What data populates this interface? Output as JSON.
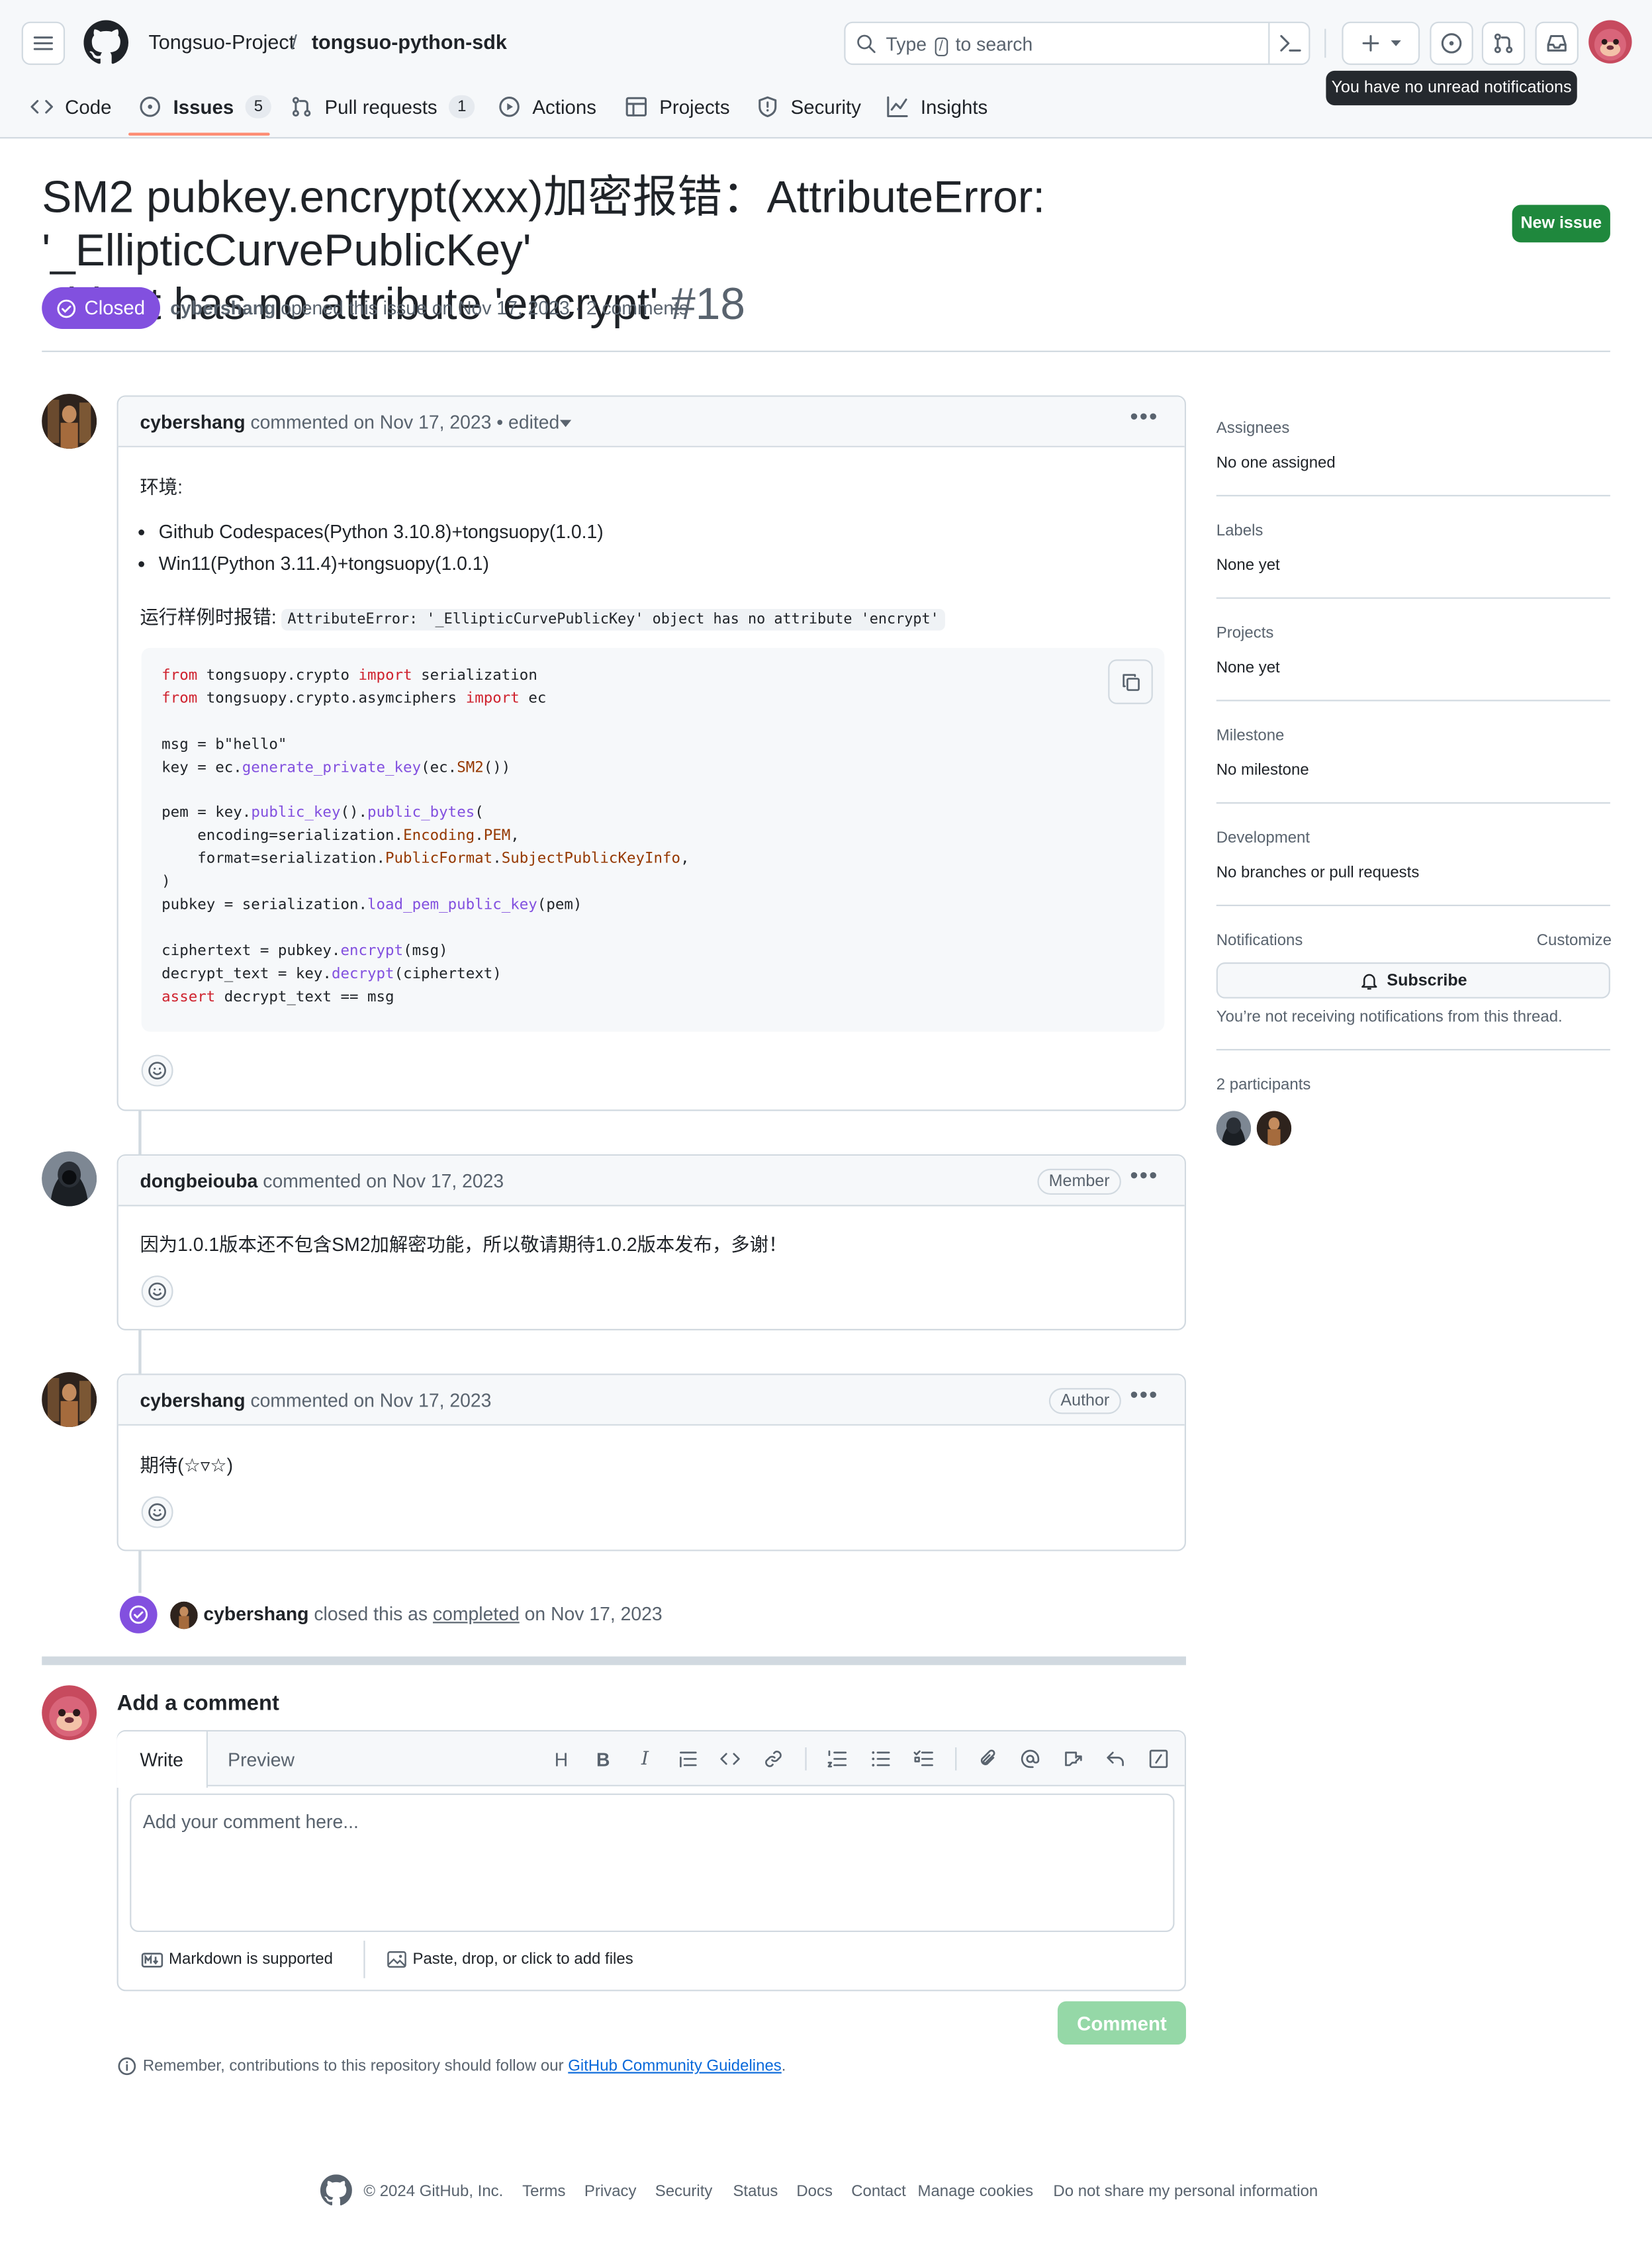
{
  "header": {
    "org": "Tongsuo-Project",
    "sep": "/",
    "repo": "tongsuo-python-sdk",
    "search_pre": "Type",
    "search_key": "/",
    "search_post": "to search",
    "tooltip": "You have no unread notifications"
  },
  "tabs": [
    {
      "label": "Code"
    },
    {
      "label": "Issues",
      "count": "5"
    },
    {
      "label": "Pull requests",
      "count": "1"
    },
    {
      "label": "Actions"
    },
    {
      "label": "Projects"
    },
    {
      "label": "Security"
    },
    {
      "label": "Insights"
    }
  ],
  "issue": {
    "title_line1": "SM2 pubkey.encrypt(xxx)加密报错：AttributeError: '_EllipticCurvePublicKey'",
    "title_line2": "object has no attribute 'encrypt'",
    "number": "#18",
    "new_issue": "New issue",
    "state": "Closed",
    "author": "cybershang",
    "opened_text": "opened this issue on Nov 17, 2023 · 2 comments"
  },
  "comments": [
    {
      "author": "cybershang",
      "meta": "commented on Nov 17, 2023 • edited",
      "env_label": "环境:",
      "bullets": [
        "Github Codespaces(Python 3.10.8)+tongsuopy(1.0.1)",
        "Win11(Python 3.11.4)+tongsuopy(1.0.1)"
      ],
      "error_label": "运行样例时报错:",
      "error_code": "AttributeError: '_EllipticCurvePublicKey' object has no attribute 'encrypt'"
    },
    {
      "author": "dongbeiouba",
      "meta": "commented on Nov 17, 2023",
      "role": "Member",
      "body": "因为1.0.1版本还不包含SM2加解密功能，所以敬请期待1.0.2版本发布，多谢！"
    },
    {
      "author": "cybershang",
      "meta": "commented on Nov 17, 2023",
      "role": "Author",
      "body": "期待(☆▿☆)"
    }
  ],
  "event": {
    "actor": "cybershang",
    "pre": "closed this as",
    "link": "completed",
    "post": "on Nov 17, 2023"
  },
  "sidebar": {
    "assignees_h": "Assignees",
    "assignees_v": "No one assigned",
    "labels_h": "Labels",
    "labels_v": "None yet",
    "projects_h": "Projects",
    "projects_v": "None yet",
    "milestone_h": "Milestone",
    "milestone_v": "No milestone",
    "development_h": "Development",
    "development_v": "No branches or pull requests",
    "notifications_h": "Notifications",
    "customize": "Customize",
    "subscribe": "Subscribe",
    "notif_note": "You’re not receiving notifications from this thread.",
    "participants": "2 participants"
  },
  "composer": {
    "heading": "Add a comment",
    "tab_write": "Write",
    "tab_preview": "Preview",
    "placeholder": "Add your comment here...",
    "markdown": "Markdown is supported",
    "files": "Paste, drop, or click to add files",
    "submit": "Comment",
    "reminder_pre": "Remember, contributions to this repository should follow our",
    "reminder_link": "GitHub Community Guidelines",
    "reminder_post": "."
  },
  "footer": [
    "© 2024 GitHub, Inc.",
    "Terms",
    "Privacy",
    "Security",
    "Status",
    "Docs",
    "Contact",
    "Manage cookies",
    "Do not share my personal information"
  ],
  "colors": {
    "accent_green": "#1f883d",
    "closed_purple": "#8250df",
    "border": "#d1d9e0",
    "link_blue": "#0969da"
  }
}
